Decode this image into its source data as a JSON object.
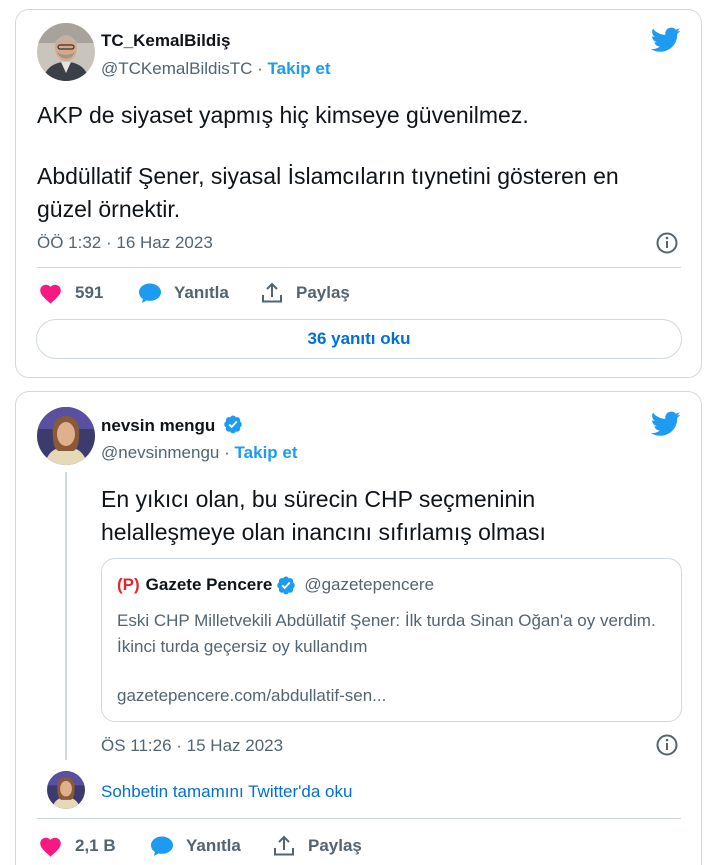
{
  "tweet1": {
    "author_name": "TC_KemalBildiş",
    "author_handle": "@TCKemalBildisTC",
    "separator": "·",
    "follow_label": "Takip et",
    "text_line1": "AKP de siyaset yapmış hiç kimseye güvenilmez.",
    "text_line2": "Abdüllatif Şener, siyasal İslamcıların tıynetini gösteren en güzel örnektir.",
    "timestamp": "ÖÖ 1:32 · 16 Haz 2023",
    "like_count": "591",
    "reply_label": "Yanıtla",
    "share_label": "Paylaş",
    "read_replies_label": "36 yanıtı oku",
    "colors": {
      "like": "#f91880",
      "reply": "#1d9bf0",
      "share": "#536471"
    }
  },
  "tweet2": {
    "author_name": "nevsin mengu",
    "verified": true,
    "author_handle": "@nevsinmengu",
    "separator": "·",
    "follow_label": "Takip et",
    "text": "En yıkıcı olan, bu sürecin CHP seçmeninin helalleşmeye olan inancını sıfırlamış olması",
    "quote": {
      "logo_text": "(P)",
      "name": "Gazete Pencere",
      "verified": true,
      "handle": "@gazetepencere",
      "text": "Eski CHP Milletvekili Abdüllatif Şener: İlk turda Sinan Oğan'a oy verdim. İkinci turda geçersiz oy kullandım",
      "link": "gazetepencere.com/abdullatif-sen..."
    },
    "timestamp": "ÖS 11:26 · 15 Haz 2023",
    "read_thread_label": "Sohbetin tamamını Twitter'da oku",
    "like_count": "2,1 B",
    "reply_label": "Yanıtla",
    "share_label": "Paylaş"
  },
  "icons": {
    "brand": "twitter-bird-icon",
    "info": "info-icon",
    "like": "heart-icon",
    "reply": "speech-bubble-icon",
    "share": "share-arrow-icon",
    "verified": "verified-badge-icon"
  },
  "brand_color": "#1d9bf0"
}
